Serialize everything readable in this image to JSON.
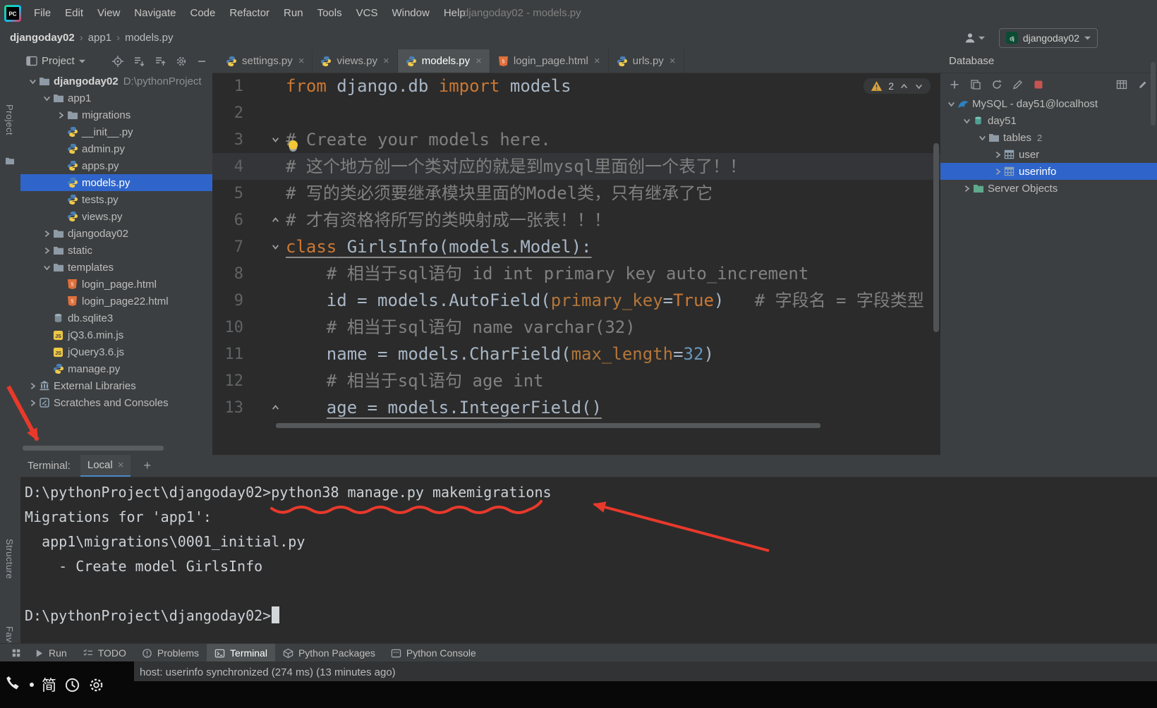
{
  "colors": {
    "selection_blue": "#2f65ca",
    "annotation_red": "#e8392b",
    "warning_yellow": "#d9a33c",
    "keyword_orange": "#cc7832"
  },
  "menu_bar": {
    "logo": "PC",
    "items": [
      "File",
      "Edit",
      "View",
      "Navigate",
      "Code",
      "Refactor",
      "Run",
      "Tools",
      "VCS",
      "Window",
      "Help"
    ],
    "window_title": "djangoday02 - models.py"
  },
  "navbar": {
    "breadcrumbs": [
      "djangoday02",
      "app1",
      "models.py"
    ],
    "run_config": {
      "label": "djangoday02"
    }
  },
  "left_strip": {
    "top_label": "Project",
    "bottom_labels": [
      "Structure",
      "Favorites"
    ]
  },
  "project_panel": {
    "header": {
      "label": "Project"
    },
    "tree": [
      {
        "depth": 0,
        "chevron": "down",
        "icon": "folder",
        "label": "djangoday02",
        "suffix": "D:\\pythonProject",
        "bold": true
      },
      {
        "depth": 1,
        "chevron": "down",
        "icon": "folder",
        "label": "app1"
      },
      {
        "depth": 2,
        "chevron": "right",
        "icon": "folder",
        "label": "migrations"
      },
      {
        "depth": 2,
        "icon": "python",
        "label": "__init__.py"
      },
      {
        "depth": 2,
        "icon": "python",
        "label": "admin.py"
      },
      {
        "depth": 2,
        "icon": "python",
        "label": "apps.py"
      },
      {
        "depth": 2,
        "icon": "python",
        "label": "models.py",
        "selected": true
      },
      {
        "depth": 2,
        "icon": "python",
        "label": "tests.py"
      },
      {
        "depth": 2,
        "icon": "python",
        "label": "views.py"
      },
      {
        "depth": 1,
        "chevron": "right",
        "icon": "folder",
        "label": "djangoday02"
      },
      {
        "depth": 1,
        "chevron": "right",
        "icon": "folder",
        "label": "static"
      },
      {
        "depth": 1,
        "chevron": "down",
        "icon": "folder",
        "label": "templates"
      },
      {
        "depth": 2,
        "icon": "html",
        "label": "login_page.html"
      },
      {
        "depth": 2,
        "icon": "html",
        "label": "login_page22.html"
      },
      {
        "depth": 1,
        "icon": "db",
        "label": "db.sqlite3"
      },
      {
        "depth": 1,
        "icon": "js",
        "label": "jQ3.6.min.js"
      },
      {
        "depth": 1,
        "icon": "js",
        "label": "jQuery3.6.js"
      },
      {
        "depth": 1,
        "icon": "python",
        "label": "manage.py"
      },
      {
        "depth": 0,
        "chevron": "right",
        "icon": "library",
        "label": "External Libraries"
      },
      {
        "depth": 0,
        "chevron": "right",
        "icon": "scratch",
        "label": "Scratches and Consoles"
      }
    ]
  },
  "editor": {
    "tabs": [
      {
        "label": "settings.py",
        "icon": "python"
      },
      {
        "label": "views.py",
        "icon": "python"
      },
      {
        "label": "models.py",
        "icon": "python",
        "active": true
      },
      {
        "label": "login_page.html",
        "icon": "html"
      },
      {
        "label": "urls.py",
        "icon": "python"
      }
    ],
    "warning": {
      "count": "2"
    },
    "lines": [
      {
        "n": "1",
        "seg": [
          [
            "kw",
            "from"
          ],
          [
            "tx",
            " django.db "
          ],
          [
            "kw",
            "import"
          ],
          [
            "tx",
            " models"
          ]
        ]
      },
      {
        "n": "2",
        "seg": []
      },
      {
        "n": "3",
        "fold": "open",
        "seg": [
          [
            "cm",
            "# Create your models here."
          ]
        ]
      },
      {
        "n": "4",
        "current": true,
        "seg": [
          [
            "cm",
            "# 这个地方创一个类对应的就是到mysql里面创一个表了！！"
          ]
        ]
      },
      {
        "n": "5",
        "seg": [
          [
            "cm",
            "# 写的类必须要继承模块里面的Model类，只有继承了它"
          ]
        ]
      },
      {
        "n": "6",
        "fold": "close",
        "seg": [
          [
            "cm",
            "# 才有资格将所写的类映射成一张表！！！"
          ]
        ]
      },
      {
        "n": "7",
        "fold": "open",
        "seg": [
          [
            "kw u",
            "class"
          ],
          [
            "tx u",
            " GirlsInfo(models.Model):"
          ]
        ]
      },
      {
        "n": "8",
        "seg": [
          [
            "cm",
            "    # 相当于sql语句 id int primary key auto_increment"
          ]
        ]
      },
      {
        "n": "9",
        "seg": [
          [
            "tx",
            "    id = models.AutoField("
          ],
          [
            "ka",
            "primary_key"
          ],
          [
            "tx",
            "="
          ],
          [
            "kw",
            "True"
          ],
          [
            "tx",
            ")   "
          ],
          [
            "cm",
            "# 字段名 = 字段类型"
          ]
        ]
      },
      {
        "n": "10",
        "seg": [
          [
            "cm",
            "    # 相当于sql语句 name varchar(32)"
          ]
        ]
      },
      {
        "n": "11",
        "seg": [
          [
            "tx",
            "    name = models.CharField("
          ],
          [
            "ka",
            "max_length"
          ],
          [
            "tx",
            "="
          ],
          [
            "num",
            "32"
          ],
          [
            "tx",
            ")"
          ]
        ]
      },
      {
        "n": "12",
        "seg": [
          [
            "cm",
            "    # 相当于sql语句 age int"
          ]
        ]
      },
      {
        "n": "13",
        "fold": "close",
        "seg": [
          [
            "tx",
            "    "
          ],
          [
            "tx u",
            "age = models.IntegerField()"
          ]
        ]
      }
    ]
  },
  "database_panel": {
    "title": "Database",
    "tree": [
      {
        "depth": 0,
        "chevron": "down",
        "icon": "mysql",
        "label": "MySQL - day51@localhost"
      },
      {
        "depth": 1,
        "chevron": "down",
        "icon": "schema",
        "label": "day51"
      },
      {
        "depth": 2,
        "chevron": "down",
        "icon": "folder",
        "label": "tables",
        "count": "2"
      },
      {
        "depth": 3,
        "chevron": "right",
        "icon": "table",
        "label": "user"
      },
      {
        "depth": 3,
        "chevron": "right",
        "icon": "table",
        "label": "userinfo",
        "selected": true
      },
      {
        "depth": 1,
        "chevron": "right",
        "icon": "folderGreen",
        "label": "Server Objects"
      }
    ]
  },
  "terminal_panel": {
    "label": "Terminal:",
    "tabs": [
      {
        "label": "Local"
      }
    ],
    "add": "+",
    "cursor": true,
    "lines": [
      "D:\\pythonProject\\djangoday02>python38 manage.py makemigrations",
      "Migrations for 'app1':",
      "  app1\\migrations\\0001_initial.py",
      "    - Create model GirlsInfo",
      "",
      "D:\\pythonProject\\djangoday02>"
    ]
  },
  "tool_window_bar": {
    "items": [
      {
        "label": "Run",
        "icon": "run"
      },
      {
        "label": "TODO",
        "icon": "todo"
      },
      {
        "label": "Problems",
        "icon": "problems"
      },
      {
        "label": "Terminal",
        "icon": "terminal",
        "active": true
      },
      {
        "label": "Python Packages",
        "icon": "packages"
      },
      {
        "label": "Python Console",
        "icon": "console"
      }
    ]
  },
  "status_bar": {
    "text": "host: userinfo synchronized (274 ms) (13 minutes ago)"
  },
  "taskbar": {
    "ime": "简"
  }
}
